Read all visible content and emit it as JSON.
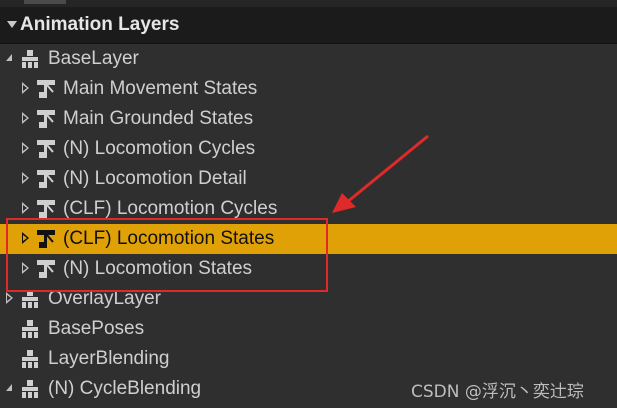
{
  "panel": {
    "title": "Animation Layers"
  },
  "tree": {
    "items": [
      {
        "label": "BaseLayer",
        "level": 0,
        "kind": "layer",
        "expanded": true,
        "selected": false
      },
      {
        "label": "Main Movement States",
        "level": 1,
        "kind": "state-machine",
        "expanded": false,
        "selected": false
      },
      {
        "label": "Main Grounded States",
        "level": 1,
        "kind": "state-machine",
        "expanded": false,
        "selected": false
      },
      {
        "label": "(N) Locomotion Cycles",
        "level": 1,
        "kind": "state-machine",
        "expanded": false,
        "selected": false
      },
      {
        "label": "(N) Locomotion Detail",
        "level": 1,
        "kind": "state-machine",
        "expanded": false,
        "selected": false
      },
      {
        "label": "(CLF) Locomotion Cycles",
        "level": 1,
        "kind": "state-machine",
        "expanded": false,
        "selected": false
      },
      {
        "label": "(CLF) Locomotion States",
        "level": 1,
        "kind": "state-machine",
        "expanded": false,
        "selected": true
      },
      {
        "label": "(N) Locomotion States",
        "level": 1,
        "kind": "state-machine",
        "expanded": false,
        "selected": false
      },
      {
        "label": "OverlayLayer",
        "level": 0,
        "kind": "layer",
        "expanded": false,
        "selected": false
      },
      {
        "label": "BasePoses",
        "level": 0,
        "kind": "layer",
        "expanded": null,
        "selected": false
      },
      {
        "label": "LayerBlending",
        "level": 0,
        "kind": "layer",
        "expanded": null,
        "selected": false
      },
      {
        "label": "(N) CycleBlending",
        "level": 0,
        "kind": "layer",
        "expanded": true,
        "selected": false
      }
    ]
  },
  "colors": {
    "selected_row": "#e0a106",
    "annotation": "#e02a2a",
    "background": "#2f2f2f",
    "header": "#1b1b1b"
  },
  "watermark": "CSDN @浮沉丶奕辻琮"
}
